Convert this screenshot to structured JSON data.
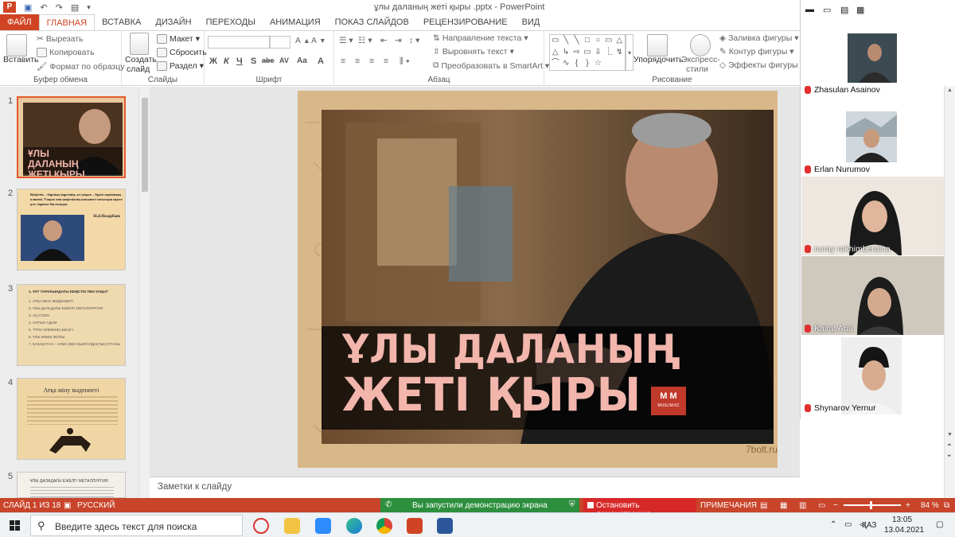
{
  "window": {
    "title": "ұлы даланың жеті қыры .pptx - PowerPoint",
    "app_logo": "P"
  },
  "tabs": [
    {
      "label": "ФАЙЛ"
    },
    {
      "label": "ГЛАВНАЯ"
    },
    {
      "label": "ВСТАВКА"
    },
    {
      "label": "ДИЗАЙН"
    },
    {
      "label": "ПЕРЕХОДЫ"
    },
    {
      "label": "АНИМАЦИЯ"
    },
    {
      "label": "ПОКАЗ СЛАЙДОВ"
    },
    {
      "label": "РЕЦЕНЗИРОВАНИЕ"
    },
    {
      "label": "ВИД"
    }
  ],
  "ribbon": {
    "clipboard": {
      "paste": "Вставить",
      "cut": "Вырезать",
      "copy": "Копировать",
      "format_painter": "Формат по образцу",
      "group": "Буфер обмена"
    },
    "slides": {
      "new_slide_1": "Создать",
      "new_slide_2": "слайд",
      "layout": "Макет",
      "reset": "Сбросить",
      "section": "Раздел",
      "group": "Слайды"
    },
    "font": {
      "group": "Шрифт",
      "buttons": [
        "Ж",
        "К",
        "Ч",
        "S",
        "abc",
        "AV",
        "Aa",
        "A"
      ]
    },
    "paragraph": {
      "text_direction": "Направление текста",
      "align_text": "Выровнять текст",
      "smartart": "Преобразовать в SmartArt",
      "group": "Абзац"
    },
    "drawing": {
      "arrange": "Упорядочить",
      "quick_styles_1": "Экспресс-",
      "quick_styles_2": "стили",
      "shape_fill": "Заливка фигуры",
      "shape_outline": "Контур фигуры",
      "shape_effects": "Эффекты фигуры",
      "group": "Рисование",
      "shapes": [
        "▭",
        "╲",
        "╲",
        "□",
        "○",
        "▭",
        "△",
        "△",
        "↳",
        "⇨",
        "▭",
        "⇩",
        "⎿",
        "↯",
        "⌒",
        "∿",
        "{",
        "}",
        "☆"
      ]
    }
  },
  "thumbnails": [
    {
      "num": "1",
      "title": "ҰЛЫ ДАЛАНЫҢ ЖЕТІ ҚЫРЫ"
    },
    {
      "num": "2",
      "text": "Кеңістік – барлық нарсенің, ал уақыт – бұкіл оқиғаның өлшемі. Уақыт пен кеңістіктің көкжиегі тоғысқан нүкте ұлт тарихы басталады.",
      "author": "Н.Ә.Назарбаев"
    },
    {
      "num": "3",
      "title": "1. ҰЛТ ТАРИХЫНДАҒЫ КЕҢІСТІК ПЕН УАҚЫТ",
      "items": [
        "1. АТҚА МІНУ МӘДЕНИЕТІ",
        "2. ҰЛЫ ДАЛАДАҒЫ ЕЖЕЛГІ МЕТАЛЛУРГИЯ",
        "3. АҢ СТИЛІ",
        "4. АЛТЫН АДАМ",
        "5. ТҮРКІ ӘЛЕМІНІҢ БЕСІГІ",
        "6. ҰЛЫ ЖІБЕК ЖОЛЫ",
        "7. ҚАЗАҚСТАН – АЛМА МЕН ҚЫЗҒАЛДАҚТЫҢ ОТАНЫ"
      ]
    },
    {
      "num": "4",
      "title": "Атқа міну мәдениеті"
    },
    {
      "num": "5",
      "title": "ҰЛЫ ДАЛАДАҒЫ ЕЖЕЛГІ МЕТАЛЛУРГИЯ"
    }
  ],
  "slide": {
    "title_line1": "ҰЛЫ ДАЛАНЫҢ",
    "title_line2": "ЖЕТІ ҚЫРЫ",
    "logo_text": "MUSLIM.KZ",
    "logo_letters": "M M",
    "watermark": "7bolt.ru"
  },
  "notes_placeholder": "Заметки к слайду",
  "status": {
    "slide_info": "СЛАЙД 1 ИЗ 18",
    "language": "РУССКИЙ",
    "share_message": "Вы запустили демонстрацию экрана",
    "stop_share": "Остановить демонстрацию",
    "notes": "ПРИМЕЧАНИЯ",
    "zoom": "84 %"
  },
  "participants": [
    {
      "name": "Zhasulan Asainov"
    },
    {
      "name": "Erlan Nurumov"
    },
    {
      "name": "nuray rakhimberdina"
    },
    {
      "name": "Kairat Arai"
    },
    {
      "name": "Shynarov Yernur"
    }
  ],
  "taskbar": {
    "search_placeholder": "Введите здесь текст для поиска",
    "lang": "ҚАЗ",
    "time": "13:05",
    "date": "13.04.2021"
  },
  "colors": {
    "accent": "#d04423",
    "share_green": "#2d8f3d",
    "stop_red": "#d72828",
    "title_pink": "#f2b6ad"
  }
}
